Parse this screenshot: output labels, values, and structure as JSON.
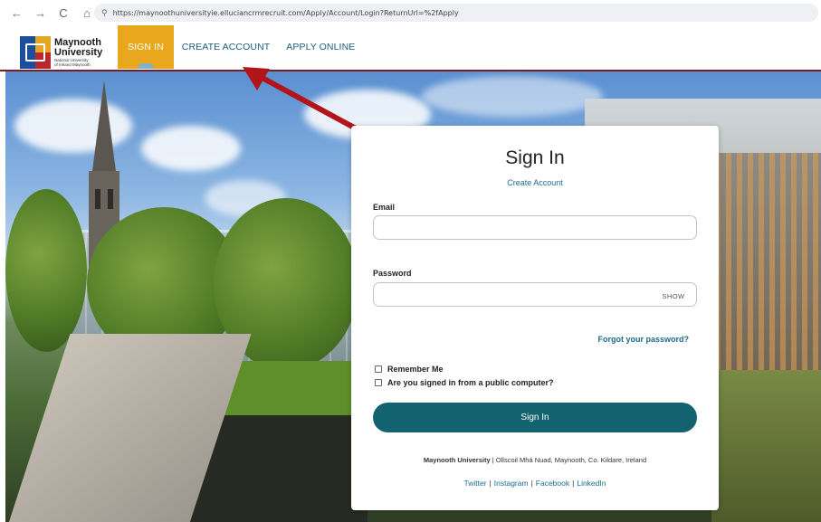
{
  "browser": {
    "back_icon": "←",
    "forward_icon": "→",
    "reload_icon": "C",
    "home_icon": "⌂",
    "site_info_icon": "⚲",
    "url": "https://maynoothuniversityie.elluciancrmrecruit.com/Apply/Account/Login?ReturnUrl=%2fApply"
  },
  "logo": {
    "name_line1": "Maynooth",
    "name_line2": "University",
    "sub_line1": "National University",
    "sub_line2": "of Ireland Maynooth"
  },
  "nav": {
    "items": [
      {
        "label": "SIGN IN",
        "active": true
      },
      {
        "label": "CREATE ACCOUNT",
        "active": false
      },
      {
        "label": "APPLY ONLINE",
        "active": false
      }
    ]
  },
  "form": {
    "title": "Sign In",
    "create_account_link": "Create Account",
    "email_label": "Email",
    "email_value": "",
    "password_label": "Password",
    "password_value": "",
    "show_label": "SHOW",
    "forgot_password": "Forgot your password?",
    "remember_me": "Remember Me",
    "public_computer": "Are you signed in from a public computer?",
    "submit_label": "Sign In"
  },
  "footer": {
    "org_name": "Maynooth University",
    "separator": "|",
    "address": "Ollscoil Mhá Nuad, Maynooth, Co. Kildare, Ireland",
    "social": [
      "Twitter",
      "Instagram",
      "Facebook",
      "LinkedIn"
    ]
  },
  "colors": {
    "accent_gold": "#e8a71c",
    "brand_teal": "#12626f",
    "link_blue": "#1b6c8c",
    "header_rule": "#7a1d1f",
    "annotation_arrow": "#b3141a"
  }
}
